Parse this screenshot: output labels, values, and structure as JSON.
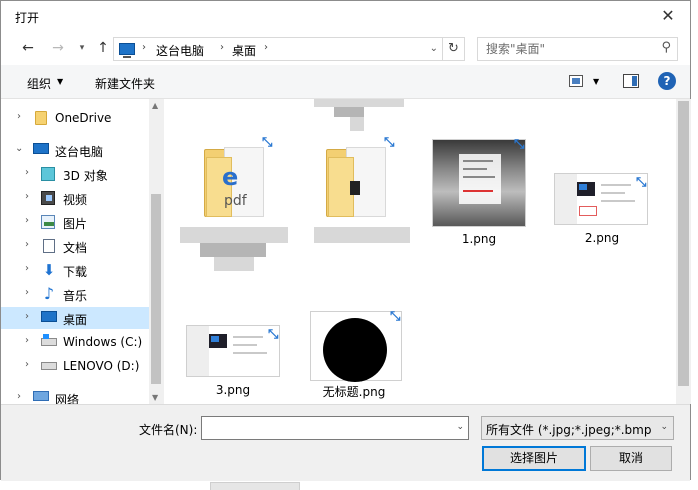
{
  "window": {
    "title": "打开",
    "close_glyph": "✕"
  },
  "nav": {
    "back_glyph": "←",
    "forward_glyph": "→",
    "recent_glyph": "▾",
    "up_glyph": "↑",
    "refresh_glyph": "↻"
  },
  "address": {
    "crumbs": [
      "这台电脑",
      "桌面"
    ],
    "sep_glyph": "›",
    "drop_glyph": "⌄"
  },
  "search": {
    "placeholder": "搜索\"桌面\"",
    "icon": "search-icon",
    "glyph": "⚲"
  },
  "toolbar": {
    "organize_label": "组织",
    "organize_arrow": "▼",
    "new_folder_label": "新建文件夹",
    "view_arrow": "▼",
    "help_label": "?"
  },
  "sidebar": {
    "chevron_right": "›",
    "chevron_down": "⌄",
    "items": [
      {
        "label": "OneDrive",
        "icon": "folder-icon"
      },
      {
        "label": "这台电脑",
        "icon": "computer-icon"
      },
      {
        "label": "3D 对象",
        "icon": "3d-objects-icon"
      },
      {
        "label": "视频",
        "icon": "video-icon"
      },
      {
        "label": "图片",
        "icon": "pictures-icon"
      },
      {
        "label": "文档",
        "icon": "documents-icon"
      },
      {
        "label": "下载",
        "icon": "download-icon",
        "glyph": "⬇"
      },
      {
        "label": "音乐",
        "icon": "music-icon",
        "glyph": "♪"
      },
      {
        "label": "桌面",
        "icon": "desktop-icon"
      },
      {
        "label": "Windows (C:)",
        "icon": "drive-icon"
      },
      {
        "label": "LENOVO (D:)",
        "icon": "drive-icon"
      },
      {
        "label": "网络",
        "icon": "network-icon"
      }
    ],
    "scroll_up": "▲",
    "scroll_down": "▼"
  },
  "files": [
    {
      "name": "",
      "type": "folder",
      "icon": "folder-icon",
      "note": "name obscured"
    },
    {
      "name": "",
      "type": "folder",
      "icon": "folder-icon",
      "note": "name obscured"
    },
    {
      "name": "1.png",
      "type": "image"
    },
    {
      "name": "2.png",
      "type": "image"
    },
    {
      "name": "3.png",
      "type": "image"
    },
    {
      "name": "无标题.png",
      "type": "image"
    }
  ],
  "thumbs": {
    "pdf_letter": "e",
    "pdf_word": "pdf",
    "shortcut_glyph": "⤡"
  },
  "footer": {
    "filename_label": "文件名(N):",
    "filename_value": "",
    "filetype_value": "所有文件 (*.jpg;*.jpeg;*.bmp;*.",
    "drop_glyph": "⌄",
    "open_label": "选择图片",
    "cancel_label": "取消"
  },
  "colors": {
    "selection": "#cce8ff",
    "accent": "#0078d7",
    "help": "#1f63b5"
  }
}
